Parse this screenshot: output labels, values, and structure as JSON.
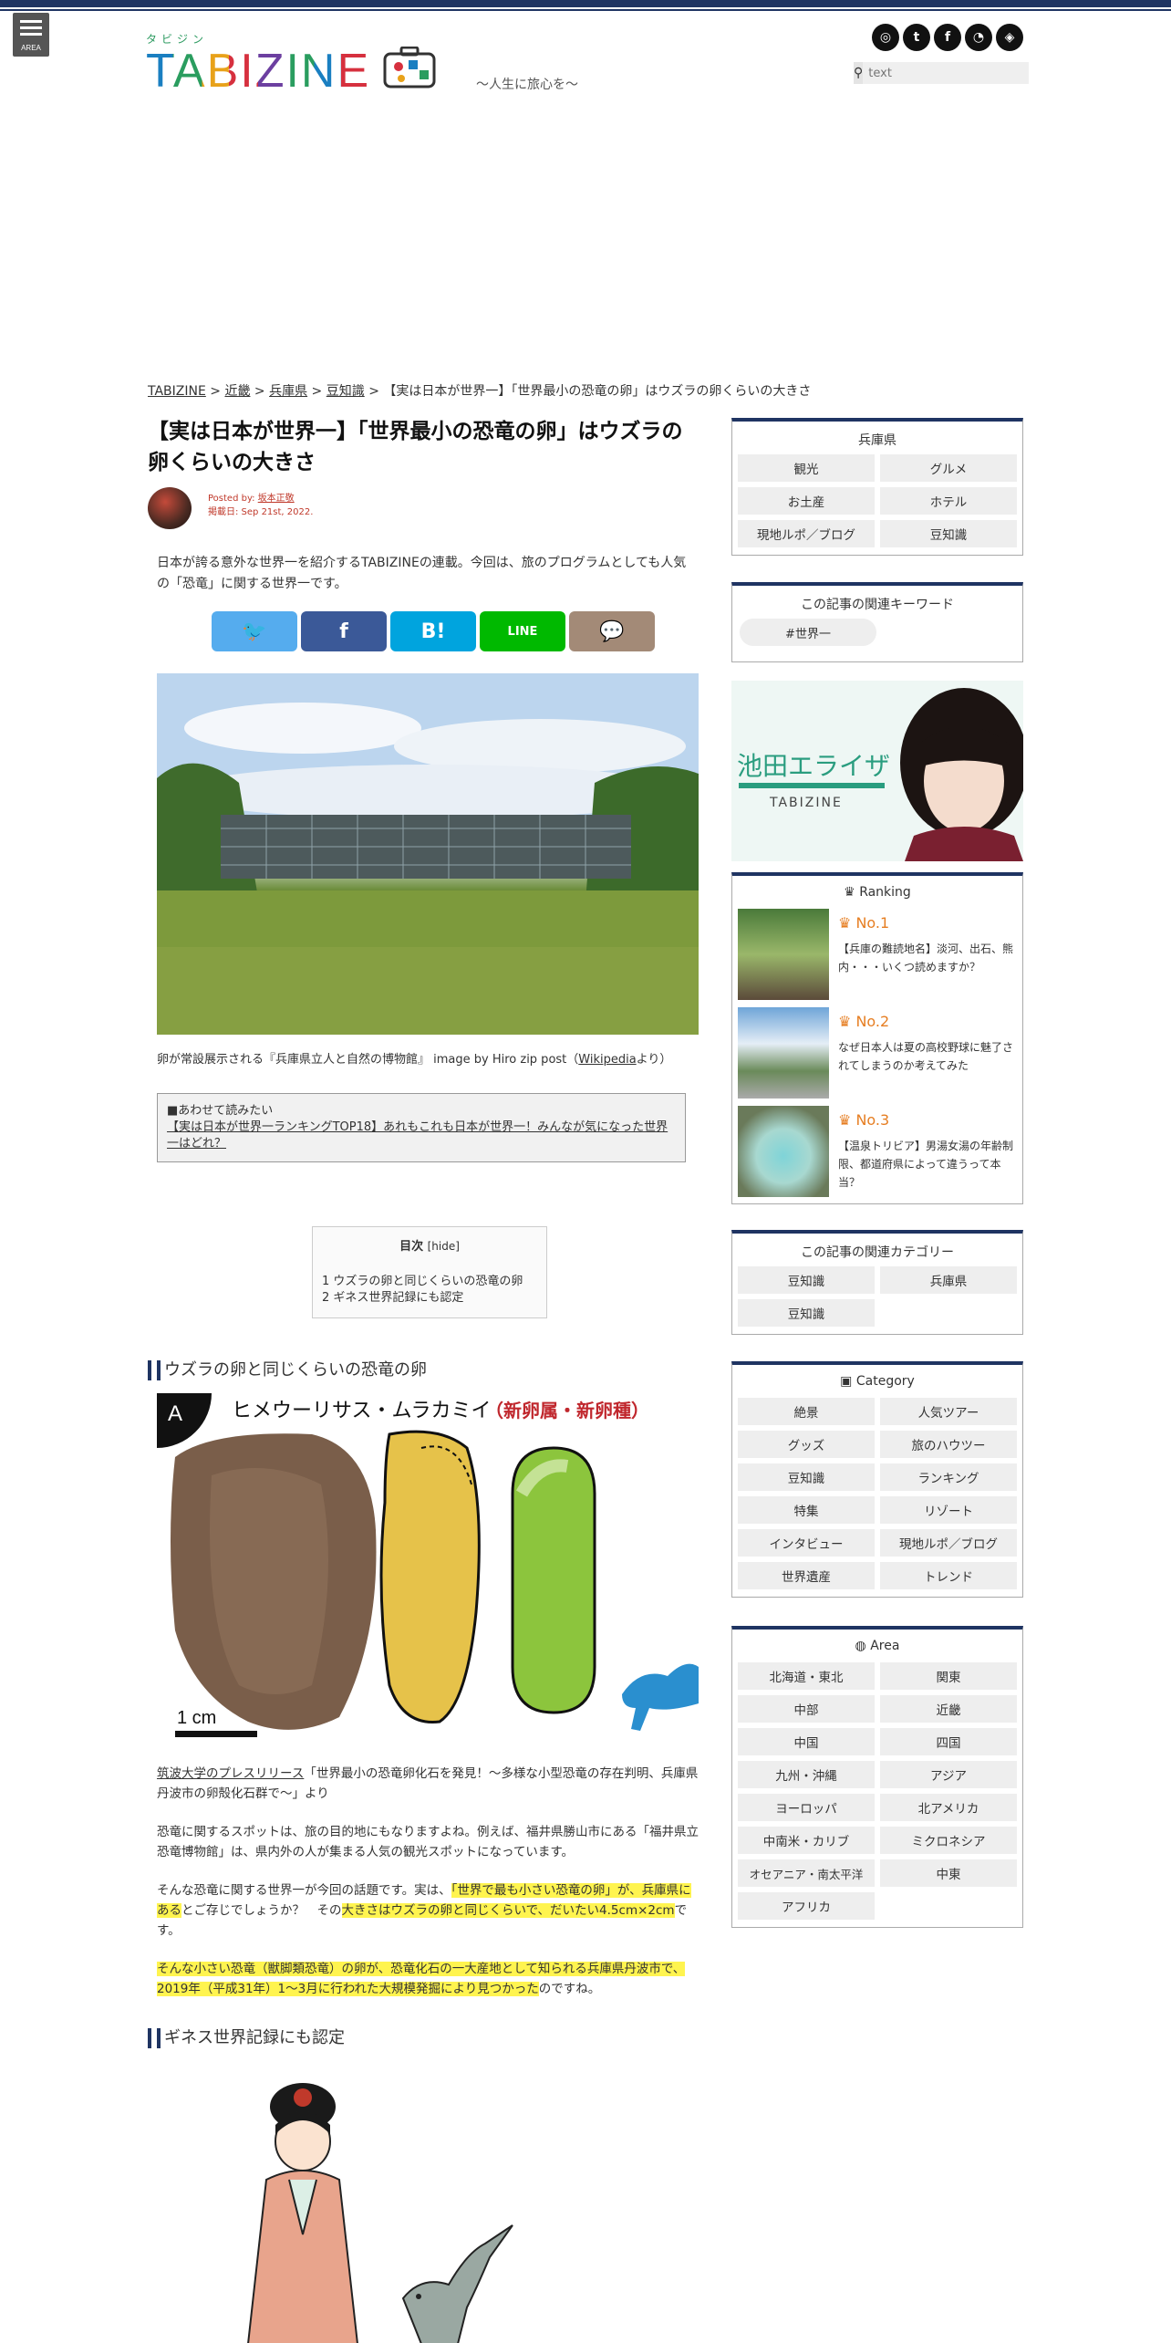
{
  "header": {
    "menu_label": "AREA",
    "logo_kana": "タビジン",
    "logo_text": "TABIZINE",
    "tagline": "～人生に旅心を～",
    "search_placeholder": "text",
    "social": [
      "instagram-icon",
      "twitter-icon",
      "facebook-icon",
      "rss-icon",
      "feedly-icon"
    ]
  },
  "breadcrumb": {
    "items": [
      "TABIZINE",
      "近畿",
      "兵庫県",
      "豆知識"
    ],
    "current": "【実は日本が世界一】「世界最小の恐竜の卵」はウズラの卵くらいの大きさ"
  },
  "article": {
    "title": "【実は日本が世界一】「世界最小の恐竜の卵」はウズラの卵くらいの大きさ",
    "posted_by_label": "Posted by: ",
    "author": "坂本正敬",
    "date_label": "掲載日: Sep 21st, 2022.",
    "intro": "日本が誇る意外な世界一を紹介するTABIZINEの連載。今回は、旅のプログラムとしても人気の「恐竜」に関する世界一です。",
    "photo_caption_1": "卵が常設展示される『兵庫県立人と自然の博物館』 image by Hiro zip post（",
    "photo_caption_link": "Wikipedia",
    "photo_caption_2": "より）",
    "related_label": "■あわせて読みたい",
    "related_link": "【実は日本が世界一ランキングTOP18】あれもこれも日本が世界一！みんなが気になった世界一はどれ？",
    "toc_title": "目次",
    "toc_hide": "[hide]",
    "toc_items": [
      "1 ウズラの卵と同じくらいの恐竜の卵",
      "2 ギネス世界記録にも認定"
    ],
    "h2_1": "ウズラの卵と同じくらいの恐竜の卵",
    "fig_badge": "A",
    "fig_title_1": "ヒメウーリサス・ムラカミイ",
    "fig_title_2": "（新卵属・新卵種）",
    "fig_scale": "1 cm",
    "fig_caption_link": "筑波大学のプレスリリース",
    "fig_caption_rest": "「世界最小の恐竜卵化石を発見！～多様な小型恐竜の存在判明、兵庫県丹波市の卵殻化石群で～」より",
    "para1": "恐竜に関するスポットは、旅の目的地にもなりますよね。例えば、福井県勝山市にある「福井県立恐竜博物館」は、県内外の人が集まる人気の観光スポットになっています。",
    "para2_a": "そんな恐竜に関する世界一が今回の話題です。実は、",
    "para2_hl1": "「世界で最も小さい恐竜の卵」が、兵庫県にある",
    "para2_b": "とご存じでしょうか？　その",
    "para2_hl2": "大きさはウズラの卵と同じくらいで、だいたい4.5cm×2cm",
    "para2_c": "です。",
    "para3_hl": "そんな小さい恐竜（獣脚類恐竜）の卵が、恐竜化石の一大産地として知られる兵庫県丹波市で、2019年（平成31年）1～3月に行われた大規模発掘により見つかった",
    "para3_end": "のですね。",
    "h2_2": "ギネス世界記録にも認定"
  },
  "sidebar": {
    "pref_title": "兵庫県",
    "pref_items": [
      "観光",
      "グルメ",
      "お土産",
      "ホテル",
      "現地ルポ／ブログ",
      "豆知識"
    ],
    "keywords_title": "この記事の関連キーワード",
    "keyword": "#世界一",
    "banner_name": "池田エライザ",
    "banner_sub": "TABIZINE",
    "ranking_title": "Ranking",
    "ranking": [
      {
        "no": "No.1",
        "title": "【兵庫の難読地名】淡河、出石、熊内・・・いくつ読めますか？"
      },
      {
        "no": "No.2",
        "title": "なぜ日本人は夏の高校野球に魅了されてしまうのか考えてみた"
      },
      {
        "no": "No.3",
        "title": "【温泉トリビア】男湯女湯の年齢制限、都道府県によって違うって本当？"
      }
    ],
    "cat_rel_title": "この記事の関連カテゴリー",
    "cat_rel_items": [
      "豆知識",
      "兵庫県",
      "豆知識"
    ],
    "category_title": "Category",
    "category_items": [
      "絶景",
      "人気ツアー",
      "グッズ",
      "旅のハウツー",
      "豆知識",
      "ランキング",
      "特集",
      "リゾート",
      "インタビュー",
      "現地ルポ／ブログ",
      "世界遺産",
      "トレンド"
    ],
    "area_title": "Area",
    "area_items": [
      "北海道・東北",
      "関東",
      "中部",
      "近畿",
      "中国",
      "四国",
      "九州・沖縄",
      "アジア",
      "ヨーロッパ",
      "北アメリカ",
      "中南米・カリブ",
      "ミクロネシア",
      "オセアニア・南太平洋",
      "中東",
      "アフリカ"
    ]
  },
  "colors": {
    "navy": "#1f3462",
    "twitter": "#55acee",
    "facebook": "#3b5998",
    "hatena": "#00a4de",
    "line": "#00b900",
    "comment": "#a38a77",
    "highlight": "#fff44f",
    "ranking": "#e67e22"
  }
}
